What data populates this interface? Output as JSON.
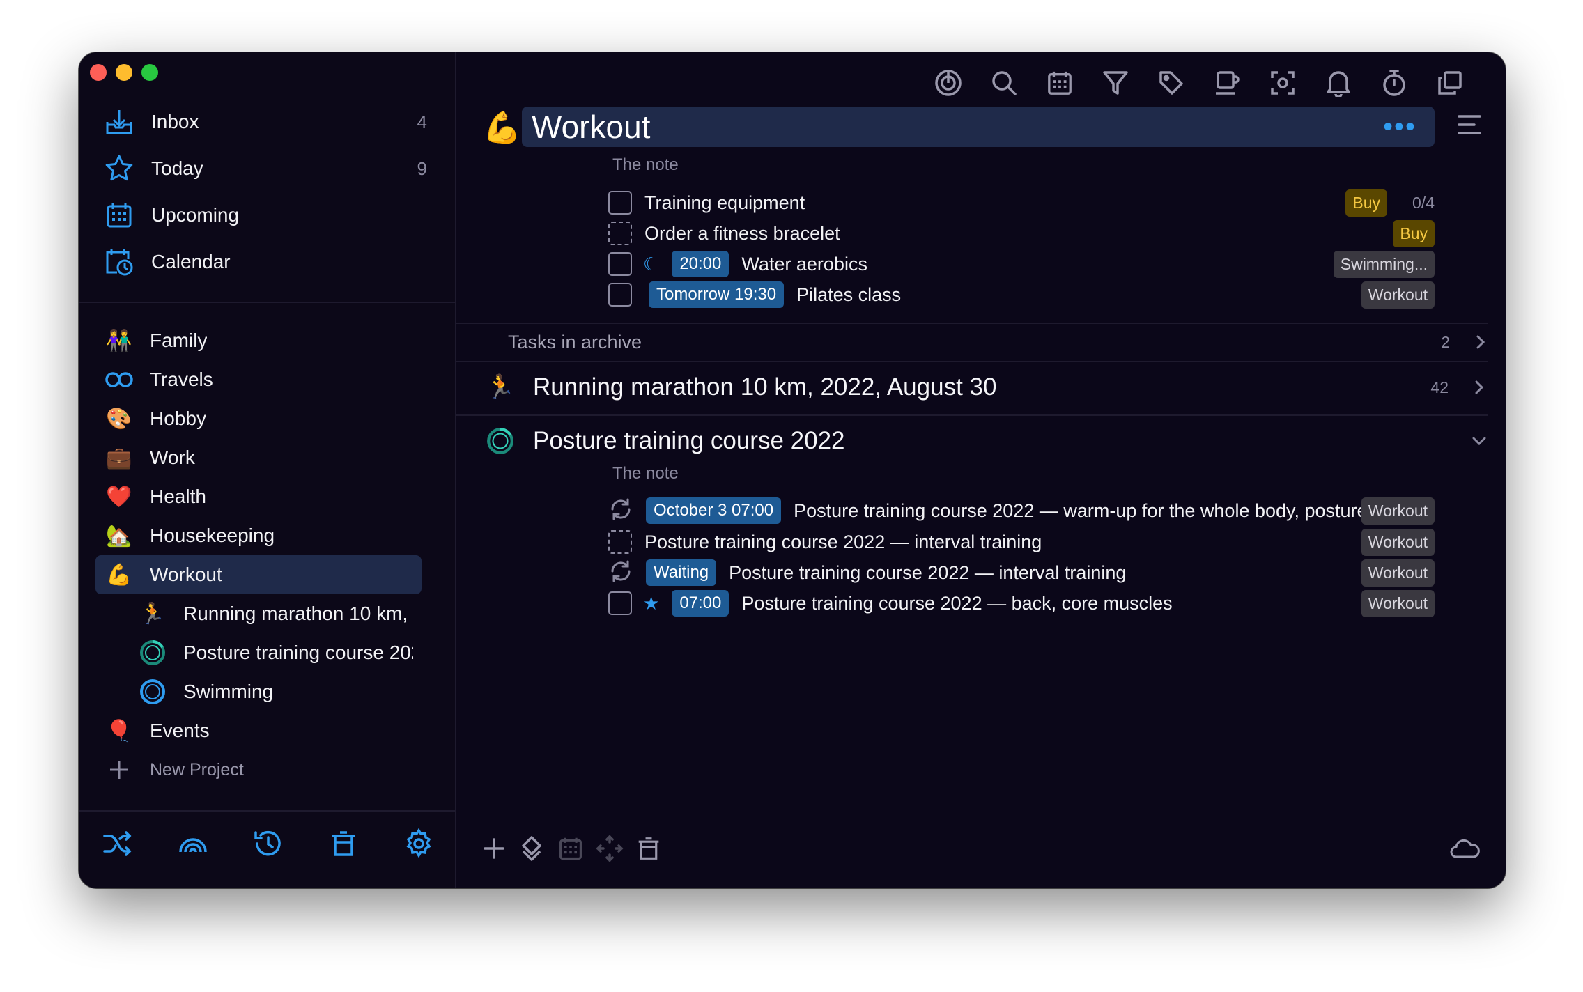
{
  "sidebar": {
    "nav": [
      {
        "label": "Inbox",
        "count": "4"
      },
      {
        "label": "Today",
        "count": "9"
      },
      {
        "label": "Upcoming",
        "count": ""
      },
      {
        "label": "Calendar",
        "count": ""
      }
    ],
    "projects": [
      {
        "label": "Family",
        "icon": "👫"
      },
      {
        "label": "Travels",
        "icon": "infinity"
      },
      {
        "label": "Hobby",
        "icon": "🎨"
      },
      {
        "label": "Work",
        "icon": "💼"
      },
      {
        "label": "Health",
        "icon": "❤️"
      },
      {
        "label": "Housekeeping",
        "icon": "🏡"
      },
      {
        "label": "Workout",
        "icon": "💪"
      },
      {
        "label": "Running marathon 10 km, 2022, August 30",
        "icon": "🏃"
      },
      {
        "label": "Posture training course 2022",
        "icon": "progress-ring-icon"
      },
      {
        "label": "Swimming",
        "icon": "ring-icon"
      },
      {
        "label": "Events",
        "icon": "🎈"
      }
    ],
    "new_project": "New Project"
  },
  "main": {
    "title": "Workout",
    "title_icon": "💪",
    "note": "The note",
    "tasks": [
      {
        "text": "Training equipment",
        "tag": "Buy",
        "count": "0/4"
      },
      {
        "text": "Order a fitness bracelet",
        "tag": "Buy"
      },
      {
        "time": "20:00",
        "text": "Water aerobics",
        "tag": "Swimming..."
      },
      {
        "time": "Tomorrow 19:30",
        "text": "Pilates class",
        "tag": "Workout"
      }
    ],
    "archive": {
      "label": "Tasks in archive",
      "count": "2"
    },
    "groups": [
      {
        "title": "Running marathon 10 km, 2022, August 30",
        "count": "42",
        "icon": "🏃"
      },
      {
        "title": "Posture training course 2022",
        "note": "The note",
        "tasks": [
          {
            "time": "October 3 07:00",
            "text": "Posture training course 2022 — warm-up for the whole body, posture",
            "tag": "Workout"
          },
          {
            "text": "Posture training course 2022 — interval training",
            "tag": "Workout"
          },
          {
            "time": "Waiting",
            "text": "Posture training course 2022 — interval training",
            "tag": "Workout"
          },
          {
            "time": "07:00",
            "text": "Posture training course 2022 — back, core muscles",
            "tag": "Workout"
          }
        ]
      }
    ]
  },
  "colors": {
    "accent": "#2f9cf0",
    "selection": "#1f2a4a",
    "background": "#0b0719",
    "buy_tag": "#f5c842"
  }
}
